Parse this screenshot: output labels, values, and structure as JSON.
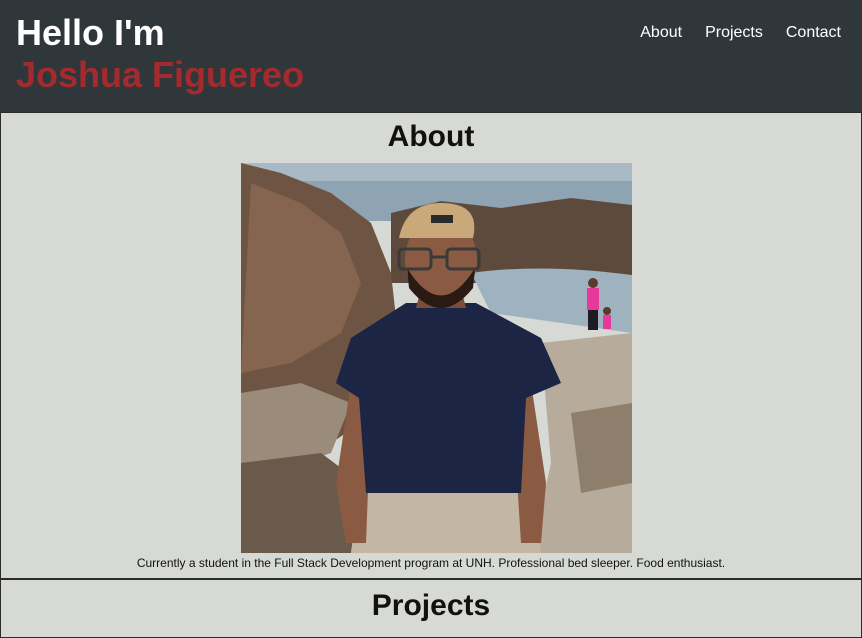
{
  "header": {
    "greeting": "Hello I'm",
    "name": "Joshua Figuereo",
    "nav": [
      {
        "label": "About"
      },
      {
        "label": "Projects"
      },
      {
        "label": "Contact"
      }
    ]
  },
  "about": {
    "title": "About",
    "caption": "Currently a student in the Full Stack Development program at UNH. Professional bed sleeper. Food enthusiast."
  },
  "projects": {
    "title": "Projects"
  },
  "colors": {
    "header_bg": "#30373b",
    "accent_name": "#a52a2e",
    "page_bg": "#d7d9d4"
  }
}
